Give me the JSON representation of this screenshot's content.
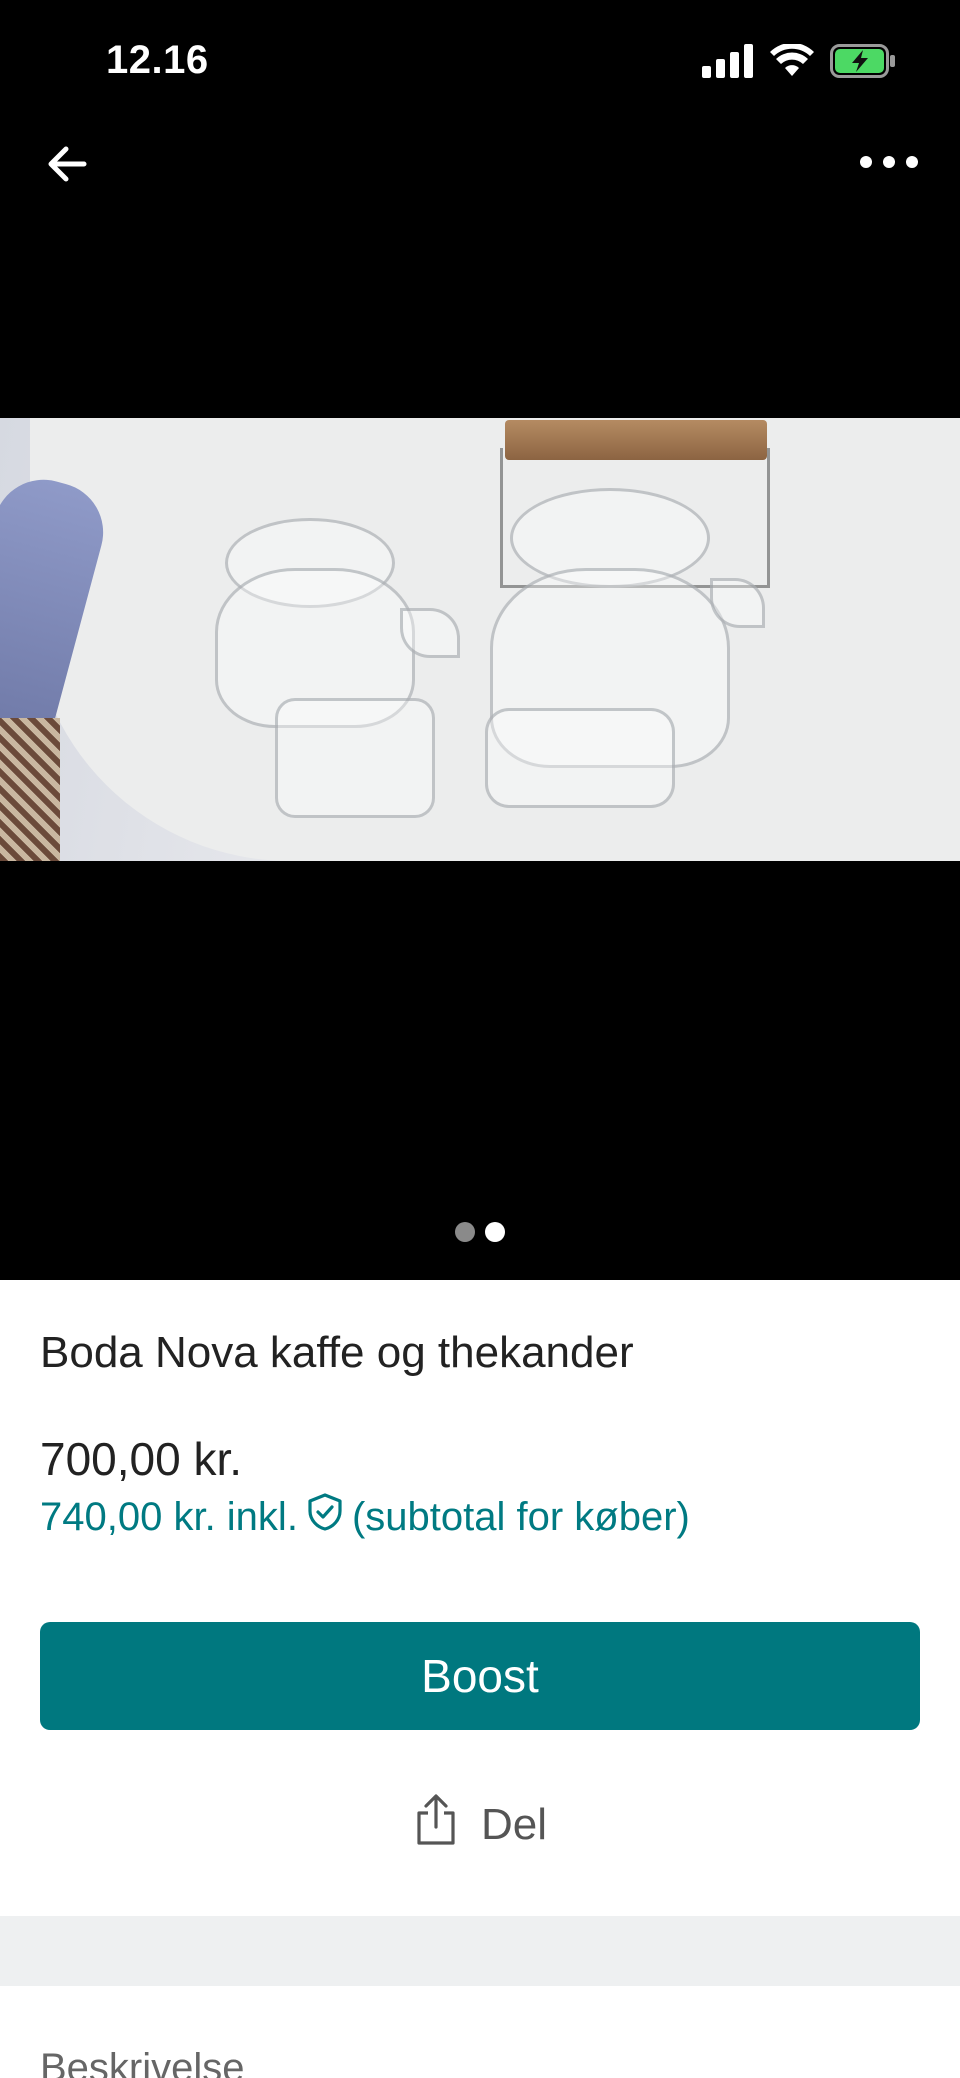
{
  "status_bar": {
    "time": "12.16",
    "icons": [
      "signal-icon",
      "wifi-icon",
      "battery-charging-icon"
    ],
    "battery_color": "#4cd964"
  },
  "navigation": {
    "back_icon": "arrow-left-icon",
    "more_icon": "more-horizontal-icon"
  },
  "gallery": {
    "image_count": 2,
    "active_index": 2
  },
  "listing": {
    "title": "Boda Nova kaffe og thekander",
    "price": "700,00 kr.",
    "subtotal_prefix": "740,00 kr. inkl.",
    "subtotal_suffix": "(subtotal for køber)",
    "protection_icon": "shield-check-icon"
  },
  "actions": {
    "boost_label": "Boost",
    "share_label": "Del",
    "share_icon": "share-icon"
  },
  "description": {
    "heading": "Beskrivelse"
  },
  "colors": {
    "accent": "#00787f",
    "accent_text": "#007a82",
    "divider": "#eef0f1"
  }
}
